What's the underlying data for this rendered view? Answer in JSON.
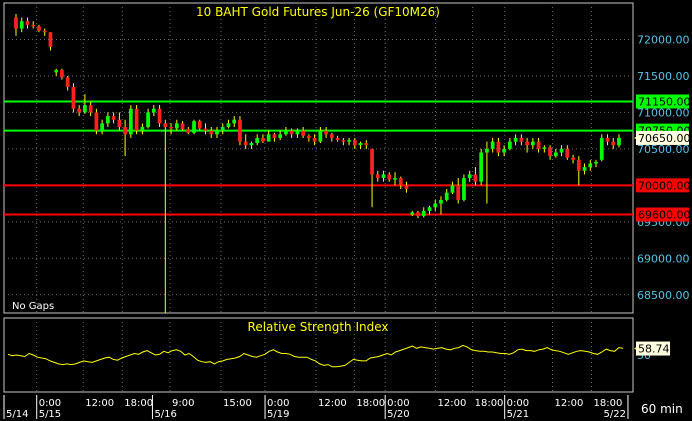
{
  "colors": {
    "background": "#000000",
    "panel_border": "#c8c8c8",
    "grid": "#6b6b6b",
    "title": "#ffff00",
    "price_axis_text": "#57c4e6",
    "time_axis_text": "#ffffff",
    "candle_up": "#00ff00",
    "candle_down": "#ff2020",
    "wick": "#ffff00",
    "level_green": "#00ff00",
    "level_red": "#ff0000",
    "rsi_line": "#ffff00"
  },
  "footer": {
    "interval": "60 min"
  },
  "chart_data": [
    {
      "type": "candlestick",
      "title": "10 BAHT Gold Futures Jun-26 (GF10M26)",
      "annotation": "No Gaps",
      "grid": true,
      "ylim": [
        68250,
        72500
      ],
      "y_ticks": [
        {
          "value": 72000,
          "label": "72000.00"
        },
        {
          "value": 71500,
          "label": "71500.00"
        },
        {
          "value": 71000,
          "label": "71000.00"
        },
        {
          "value": 70500,
          "label": "70500.00"
        },
        {
          "value": 70000,
          "label": "70000.00"
        },
        {
          "value": 69500,
          "label": "69500.00"
        },
        {
          "value": 69000,
          "label": "69000.00"
        },
        {
          "value": 68500,
          "label": "68500.00"
        }
      ],
      "levels": [
        {
          "value": 71150,
          "label": "71150.00",
          "color": "green"
        },
        {
          "value": 70750,
          "label": "70750.00",
          "color": "green"
        },
        {
          "value": 70000,
          "label": "70000.00",
          "color": "red"
        },
        {
          "value": 69600,
          "label": "69600.00",
          "color": "red"
        }
      ],
      "last_price": {
        "value": 70650,
        "label": "70650.00"
      },
      "candles": [
        {
          "o": 72300,
          "h": 72350,
          "l": 72050,
          "c": 72150
        },
        {
          "o": 72150,
          "h": 72300,
          "l": 72100,
          "c": 72250
        },
        {
          "o": 72250,
          "h": 72300,
          "l": 72150,
          "c": 72200
        },
        {
          "o": 72200,
          "h": 72250,
          "l": 72150,
          "c": 72180
        },
        {
          "o": 72180,
          "h": 72200,
          "l": 72100,
          "c": 72120
        },
        {
          "o": 72120,
          "h": 72150,
          "l": 72050,
          "c": 72100
        },
        {
          "o": 72100,
          "h": 72100,
          "l": 71850,
          "c": 71900
        },
        {
          "o": 71550,
          "h": 71600,
          "l": 71500,
          "c": 71580
        },
        {
          "o": 71580,
          "h": 71600,
          "l": 71450,
          "c": 71480
        },
        {
          "o": 71480,
          "h": 71500,
          "l": 71300,
          "c": 71350
        },
        {
          "o": 71350,
          "h": 71400,
          "l": 71000,
          "c": 71050
        },
        {
          "o": 71050,
          "h": 71100,
          "l": 70950,
          "c": 71000
        },
        {
          "o": 71000,
          "h": 71250,
          "l": 70980,
          "c": 71100
        },
        {
          "o": 71100,
          "h": 71150,
          "l": 70950,
          "c": 71000
        },
        {
          "o": 71000,
          "h": 71050,
          "l": 70700,
          "c": 70750
        },
        {
          "o": 70750,
          "h": 70900,
          "l": 70700,
          "c": 70850
        },
        {
          "o": 70850,
          "h": 71000,
          "l": 70800,
          "c": 70950
        },
        {
          "o": 70950,
          "h": 71000,
          "l": 70850,
          "c": 70900
        },
        {
          "o": 70900,
          "h": 71000,
          "l": 70750,
          "c": 70800
        },
        {
          "o": 70800,
          "h": 70900,
          "l": 70400,
          "c": 70700
        },
        {
          "o": 70700,
          "h": 71100,
          "l": 70650,
          "c": 71050
        },
        {
          "o": 71050,
          "h": 71100,
          "l": 70700,
          "c": 70750
        },
        {
          "o": 70750,
          "h": 70850,
          "l": 70700,
          "c": 70800
        },
        {
          "o": 70800,
          "h": 71050,
          "l": 70780,
          "c": 71000
        },
        {
          "o": 71000,
          "h": 71100,
          "l": 70950,
          "c": 71050
        },
        {
          "o": 71050,
          "h": 71100,
          "l": 70800,
          "c": 70850
        },
        {
          "o": 70850,
          "h": 70900,
          "l": 68250,
          "c": 70800
        },
        {
          "o": 70800,
          "h": 70850,
          "l": 70700,
          "c": 70780
        },
        {
          "o": 70780,
          "h": 70900,
          "l": 70750,
          "c": 70850
        },
        {
          "o": 70850,
          "h": 70880,
          "l": 70750,
          "c": 70770
        },
        {
          "o": 70770,
          "h": 70800,
          "l": 70700,
          "c": 70720
        },
        {
          "o": 70720,
          "h": 70900,
          "l": 70700,
          "c": 70880
        },
        {
          "o": 70880,
          "h": 70900,
          "l": 70750,
          "c": 70780
        },
        {
          "o": 70780,
          "h": 70850,
          "l": 70700,
          "c": 70750
        },
        {
          "o": 70750,
          "h": 70800,
          "l": 70650,
          "c": 70700
        },
        {
          "o": 70700,
          "h": 70800,
          "l": 70650,
          "c": 70750
        },
        {
          "o": 70750,
          "h": 70850,
          "l": 70700,
          "c": 70800
        },
        {
          "o": 70800,
          "h": 70900,
          "l": 70780,
          "c": 70850
        },
        {
          "o": 70850,
          "h": 70950,
          "l": 70800,
          "c": 70900
        },
        {
          "o": 70900,
          "h": 70950,
          "l": 70550,
          "c": 70600
        },
        {
          "o": 70600,
          "h": 70700,
          "l": 70500,
          "c": 70550
        },
        {
          "o": 70550,
          "h": 70600,
          "l": 70500,
          "c": 70580
        },
        {
          "o": 70580,
          "h": 70700,
          "l": 70550,
          "c": 70650
        },
        {
          "o": 70650,
          "h": 70700,
          "l": 70580,
          "c": 70600
        },
        {
          "o": 70600,
          "h": 70750,
          "l": 70600,
          "c": 70700
        },
        {
          "o": 70700,
          "h": 70720,
          "l": 70600,
          "c": 70650
        },
        {
          "o": 70650,
          "h": 70750,
          "l": 70620,
          "c": 70700
        },
        {
          "o": 70700,
          "h": 70800,
          "l": 70680,
          "c": 70750
        },
        {
          "o": 70750,
          "h": 70780,
          "l": 70650,
          "c": 70700
        },
        {
          "o": 70700,
          "h": 70780,
          "l": 70650,
          "c": 70750
        },
        {
          "o": 70750,
          "h": 70800,
          "l": 70650,
          "c": 70680
        },
        {
          "o": 70680,
          "h": 70700,
          "l": 70600,
          "c": 70650
        },
        {
          "o": 70650,
          "h": 70700,
          "l": 70550,
          "c": 70600
        },
        {
          "o": 70600,
          "h": 70800,
          "l": 70580,
          "c": 70750
        },
        {
          "o": 70750,
          "h": 70800,
          "l": 70650,
          "c": 70700
        },
        {
          "o": 70700,
          "h": 70720,
          "l": 70600,
          "c": 70650
        },
        {
          "o": 70650,
          "h": 70680,
          "l": 70600,
          "c": 70620
        },
        {
          "o": 70620,
          "h": 70650,
          "l": 70550,
          "c": 70600
        },
        {
          "o": 70600,
          "h": 70650,
          "l": 70550,
          "c": 70620
        },
        {
          "o": 70620,
          "h": 70650,
          "l": 70500,
          "c": 70550
        },
        {
          "o": 70550,
          "h": 70600,
          "l": 70500,
          "c": 70580
        },
        {
          "o": 70580,
          "h": 70620,
          "l": 70500,
          "c": 70550
        },
        {
          "o": 70500,
          "h": 70500,
          "l": 69700,
          "c": 70150
        },
        {
          "o": 70150,
          "h": 70200,
          "l": 70050,
          "c": 70100
        },
        {
          "o": 70100,
          "h": 70200,
          "l": 70050,
          "c": 70150
        },
        {
          "o": 70150,
          "h": 70180,
          "l": 70050,
          "c": 70080
        },
        {
          "o": 70080,
          "h": 70180,
          "l": 70000,
          "c": 70100
        },
        {
          "o": 70100,
          "h": 70120,
          "l": 69950,
          "c": 70000
        },
        {
          "o": 70000,
          "h": 70050,
          "l": 69900,
          "c": 69950
        },
        {
          "o": 69600,
          "h": 69650,
          "l": 69580,
          "c": 69630
        },
        {
          "o": 69630,
          "h": 69650,
          "l": 69550,
          "c": 69580
        },
        {
          "o": 69580,
          "h": 69700,
          "l": 69560,
          "c": 69650
        },
        {
          "o": 69650,
          "h": 69720,
          "l": 69600,
          "c": 69700
        },
        {
          "o": 69700,
          "h": 69800,
          "l": 69650,
          "c": 69750
        },
        {
          "o": 69750,
          "h": 69850,
          "l": 69600,
          "c": 69800
        },
        {
          "o": 69800,
          "h": 69950,
          "l": 69780,
          "c": 69900
        },
        {
          "o": 69900,
          "h": 70050,
          "l": 69880,
          "c": 70000
        },
        {
          "o": 70000,
          "h": 70100,
          "l": 69750,
          "c": 69800
        },
        {
          "o": 69800,
          "h": 70150,
          "l": 69780,
          "c": 70100
        },
        {
          "o": 70100,
          "h": 70200,
          "l": 70050,
          "c": 70150
        },
        {
          "o": 70150,
          "h": 70250,
          "l": 70000,
          "c": 70050
        },
        {
          "o": 70050,
          "h": 70500,
          "l": 70000,
          "c": 70450
        },
        {
          "o": 70450,
          "h": 70600,
          "l": 69750,
          "c": 70500
        },
        {
          "o": 70500,
          "h": 70650,
          "l": 70450,
          "c": 70600
        },
        {
          "o": 70600,
          "h": 70650,
          "l": 70400,
          "c": 70450
        },
        {
          "o": 70450,
          "h": 70550,
          "l": 70400,
          "c": 70500
        },
        {
          "o": 70500,
          "h": 70650,
          "l": 70480,
          "c": 70600
        },
        {
          "o": 70600,
          "h": 70700,
          "l": 70550,
          "c": 70650
        },
        {
          "o": 70650,
          "h": 70700,
          "l": 70550,
          "c": 70600
        },
        {
          "o": 70600,
          "h": 70650,
          "l": 70450,
          "c": 70550
        },
        {
          "o": 70550,
          "h": 70650,
          "l": 70500,
          "c": 70600
        },
        {
          "o": 70600,
          "h": 70650,
          "l": 70450,
          "c": 70500
        },
        {
          "o": 70500,
          "h": 70550,
          "l": 70450,
          "c": 70520
        },
        {
          "o": 70520,
          "h": 70550,
          "l": 70350,
          "c": 70400
        },
        {
          "o": 70400,
          "h": 70500,
          "l": 70380,
          "c": 70450
        },
        {
          "o": 70450,
          "h": 70550,
          "l": 70400,
          "c": 70500
        },
        {
          "o": 70500,
          "h": 70550,
          "l": 70350,
          "c": 70380
        },
        {
          "o": 70380,
          "h": 70420,
          "l": 70300,
          "c": 70350
        },
        {
          "o": 70350,
          "h": 70400,
          "l": 70000,
          "c": 70200
        },
        {
          "o": 70200,
          "h": 70300,
          "l": 70150,
          "c": 70250
        },
        {
          "o": 70250,
          "h": 70350,
          "l": 70200,
          "c": 70300
        },
        {
          "o": 70300,
          "h": 70350,
          "l": 70250,
          "c": 70320
        },
        {
          "o": 70350,
          "h": 70700,
          "l": 70330,
          "c": 70650
        },
        {
          "o": 70650,
          "h": 70700,
          "l": 70550,
          "c": 70600
        },
        {
          "o": 70600,
          "h": 70650,
          "l": 70500,
          "c": 70550
        },
        {
          "o": 70550,
          "h": 70700,
          "l": 70520,
          "c": 70650
        }
      ]
    },
    {
      "type": "line",
      "title": "Relative Strength Index",
      "ylim": [
        0,
        100
      ],
      "y_ticks": [
        {
          "value": 50,
          "label": "50"
        }
      ],
      "last_value": {
        "value": 58.74,
        "label": "58.74"
      },
      "series": [
        {
          "values": [
            51,
            49,
            50,
            49,
            48,
            52,
            50,
            47,
            46,
            45,
            42,
            40,
            38,
            37,
            38,
            37,
            38,
            40,
            42,
            41,
            40,
            42,
            44,
            46,
            47,
            44,
            43,
            46,
            48,
            50,
            52,
            51,
            54,
            56,
            53,
            50,
            51,
            55,
            53,
            56,
            57,
            55,
            50,
            52,
            48,
            43,
            41,
            40,
            41,
            38,
            41,
            42,
            44,
            45,
            46,
            48,
            52,
            50,
            48,
            47,
            49,
            51,
            55,
            57,
            54,
            52,
            52,
            51,
            48,
            47,
            47,
            47,
            44,
            42,
            38,
            36,
            37,
            34,
            34,
            35,
            36,
            40,
            44,
            43,
            42,
            42,
            46,
            47,
            48,
            50,
            52,
            50,
            54,
            56,
            58,
            60,
            62,
            59,
            61,
            60,
            59,
            58,
            59,
            60,
            58,
            57,
            59,
            60,
            63,
            61,
            57,
            56,
            55,
            55,
            54,
            54,
            53,
            52,
            52,
            51,
            53,
            57,
            58,
            56,
            56,
            55,
            57,
            58,
            60,
            57,
            56,
            55,
            53,
            51,
            53,
            55,
            56,
            55,
            54,
            52,
            51,
            54,
            58,
            56,
            55,
            60,
            59
          ]
        }
      ]
    }
  ],
  "time_axis": {
    "labels": [
      {
        "text": "5/14",
        "pos": 0.0,
        "row": 2
      },
      {
        "text": "5/15",
        "pos": 0.052,
        "row": 2
      },
      {
        "text": "0:00",
        "pos": 0.052,
        "row": 1
      },
      {
        "text": "12:00",
        "pos": 0.126,
        "row": 1
      },
      {
        "text": "18:00",
        "pos": 0.188,
        "row": 1
      },
      {
        "text": "5/16",
        "pos": 0.236,
        "row": 2
      },
      {
        "text": "9:00",
        "pos": 0.264,
        "row": 1
      },
      {
        "text": "15:00",
        "pos": 0.345,
        "row": 1
      },
      {
        "text": "5/19",
        "pos": 0.415,
        "row": 2
      },
      {
        "text": "0:00",
        "pos": 0.415,
        "row": 1
      },
      {
        "text": "12:00",
        "pos": 0.496,
        "row": 1
      },
      {
        "text": "18:00",
        "pos": 0.557,
        "row": 1
      },
      {
        "text": "5/20",
        "pos": 0.606,
        "row": 2
      },
      {
        "text": "0:00",
        "pos": 0.606,
        "row": 1
      },
      {
        "text": "12:00",
        "pos": 0.686,
        "row": 1
      },
      {
        "text": "18:00",
        "pos": 0.745,
        "row": 1
      },
      {
        "text": "5/21",
        "pos": 0.796,
        "row": 2
      },
      {
        "text": "0:00",
        "pos": 0.796,
        "row": 1
      },
      {
        "text": "12:00",
        "pos": 0.872,
        "row": 1
      },
      {
        "text": "18:00",
        "pos": 0.934,
        "row": 1
      },
      {
        "text": "5/22",
        "pos": 0.992,
        "row": 2
      }
    ]
  }
}
